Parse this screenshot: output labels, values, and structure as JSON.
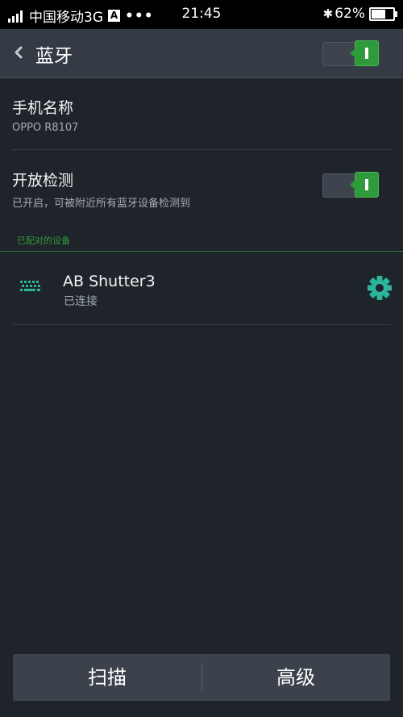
{
  "status_bar": {
    "carrier": "中国移动3G",
    "badge": "A",
    "more": "•••",
    "time": "21:45",
    "bluetooth_symbol": "✱",
    "battery": "62%",
    "battery_level": 0.62,
    "icons": [
      "signal-icon",
      "bluetooth-icon",
      "battery-icon"
    ]
  },
  "header": {
    "title": "蓝牙",
    "bluetooth_enabled": true
  },
  "settings": {
    "device_name_label": "手机名称",
    "device_name_value": "OPPO R8107",
    "discoverable_label": "开放检测",
    "discoverable_desc": "已开启，可被附近所有蓝牙设备检测到",
    "discoverable_enabled": true
  },
  "paired": {
    "section_label": "已配对的设备",
    "devices": [
      {
        "name": "AB Shutter3",
        "status": "已连接",
        "icon": "keyboard-icon"
      }
    ]
  },
  "bottom_bar": {
    "scan_label": "扫描",
    "advanced_label": "高级"
  },
  "colors": {
    "background": "#1f232a",
    "header": "#353b44",
    "accent_green": "#2f9a3c",
    "teal_icon": "#2bb69b"
  }
}
